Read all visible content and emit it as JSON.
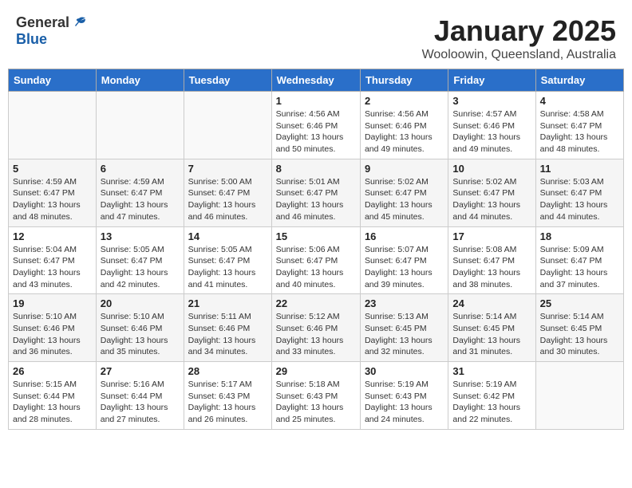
{
  "header": {
    "logo_general": "General",
    "logo_blue": "Blue",
    "title": "January 2025",
    "location": "Wooloowin, Queensland, Australia"
  },
  "weekdays": [
    "Sunday",
    "Monday",
    "Tuesday",
    "Wednesday",
    "Thursday",
    "Friday",
    "Saturday"
  ],
  "weeks": [
    [
      {
        "day": "",
        "info": ""
      },
      {
        "day": "",
        "info": ""
      },
      {
        "day": "",
        "info": ""
      },
      {
        "day": "1",
        "info": "Sunrise: 4:56 AM\nSunset: 6:46 PM\nDaylight: 13 hours\nand 50 minutes."
      },
      {
        "day": "2",
        "info": "Sunrise: 4:56 AM\nSunset: 6:46 PM\nDaylight: 13 hours\nand 49 minutes."
      },
      {
        "day": "3",
        "info": "Sunrise: 4:57 AM\nSunset: 6:46 PM\nDaylight: 13 hours\nand 49 minutes."
      },
      {
        "day": "4",
        "info": "Sunrise: 4:58 AM\nSunset: 6:47 PM\nDaylight: 13 hours\nand 48 minutes."
      }
    ],
    [
      {
        "day": "5",
        "info": "Sunrise: 4:59 AM\nSunset: 6:47 PM\nDaylight: 13 hours\nand 48 minutes."
      },
      {
        "day": "6",
        "info": "Sunrise: 4:59 AM\nSunset: 6:47 PM\nDaylight: 13 hours\nand 47 minutes."
      },
      {
        "day": "7",
        "info": "Sunrise: 5:00 AM\nSunset: 6:47 PM\nDaylight: 13 hours\nand 46 minutes."
      },
      {
        "day": "8",
        "info": "Sunrise: 5:01 AM\nSunset: 6:47 PM\nDaylight: 13 hours\nand 46 minutes."
      },
      {
        "day": "9",
        "info": "Sunrise: 5:02 AM\nSunset: 6:47 PM\nDaylight: 13 hours\nand 45 minutes."
      },
      {
        "day": "10",
        "info": "Sunrise: 5:02 AM\nSunset: 6:47 PM\nDaylight: 13 hours\nand 44 minutes."
      },
      {
        "day": "11",
        "info": "Sunrise: 5:03 AM\nSunset: 6:47 PM\nDaylight: 13 hours\nand 44 minutes."
      }
    ],
    [
      {
        "day": "12",
        "info": "Sunrise: 5:04 AM\nSunset: 6:47 PM\nDaylight: 13 hours\nand 43 minutes."
      },
      {
        "day": "13",
        "info": "Sunrise: 5:05 AM\nSunset: 6:47 PM\nDaylight: 13 hours\nand 42 minutes."
      },
      {
        "day": "14",
        "info": "Sunrise: 5:05 AM\nSunset: 6:47 PM\nDaylight: 13 hours\nand 41 minutes."
      },
      {
        "day": "15",
        "info": "Sunrise: 5:06 AM\nSunset: 6:47 PM\nDaylight: 13 hours\nand 40 minutes."
      },
      {
        "day": "16",
        "info": "Sunrise: 5:07 AM\nSunset: 6:47 PM\nDaylight: 13 hours\nand 39 minutes."
      },
      {
        "day": "17",
        "info": "Sunrise: 5:08 AM\nSunset: 6:47 PM\nDaylight: 13 hours\nand 38 minutes."
      },
      {
        "day": "18",
        "info": "Sunrise: 5:09 AM\nSunset: 6:47 PM\nDaylight: 13 hours\nand 37 minutes."
      }
    ],
    [
      {
        "day": "19",
        "info": "Sunrise: 5:10 AM\nSunset: 6:46 PM\nDaylight: 13 hours\nand 36 minutes."
      },
      {
        "day": "20",
        "info": "Sunrise: 5:10 AM\nSunset: 6:46 PM\nDaylight: 13 hours\nand 35 minutes."
      },
      {
        "day": "21",
        "info": "Sunrise: 5:11 AM\nSunset: 6:46 PM\nDaylight: 13 hours\nand 34 minutes."
      },
      {
        "day": "22",
        "info": "Sunrise: 5:12 AM\nSunset: 6:46 PM\nDaylight: 13 hours\nand 33 minutes."
      },
      {
        "day": "23",
        "info": "Sunrise: 5:13 AM\nSunset: 6:45 PM\nDaylight: 13 hours\nand 32 minutes."
      },
      {
        "day": "24",
        "info": "Sunrise: 5:14 AM\nSunset: 6:45 PM\nDaylight: 13 hours\nand 31 minutes."
      },
      {
        "day": "25",
        "info": "Sunrise: 5:14 AM\nSunset: 6:45 PM\nDaylight: 13 hours\nand 30 minutes."
      }
    ],
    [
      {
        "day": "26",
        "info": "Sunrise: 5:15 AM\nSunset: 6:44 PM\nDaylight: 13 hours\nand 28 minutes."
      },
      {
        "day": "27",
        "info": "Sunrise: 5:16 AM\nSunset: 6:44 PM\nDaylight: 13 hours\nand 27 minutes."
      },
      {
        "day": "28",
        "info": "Sunrise: 5:17 AM\nSunset: 6:43 PM\nDaylight: 13 hours\nand 26 minutes."
      },
      {
        "day": "29",
        "info": "Sunrise: 5:18 AM\nSunset: 6:43 PM\nDaylight: 13 hours\nand 25 minutes."
      },
      {
        "day": "30",
        "info": "Sunrise: 5:19 AM\nSunset: 6:43 PM\nDaylight: 13 hours\nand 24 minutes."
      },
      {
        "day": "31",
        "info": "Sunrise: 5:19 AM\nSunset: 6:42 PM\nDaylight: 13 hours\nand 22 minutes."
      },
      {
        "day": "",
        "info": ""
      }
    ]
  ]
}
